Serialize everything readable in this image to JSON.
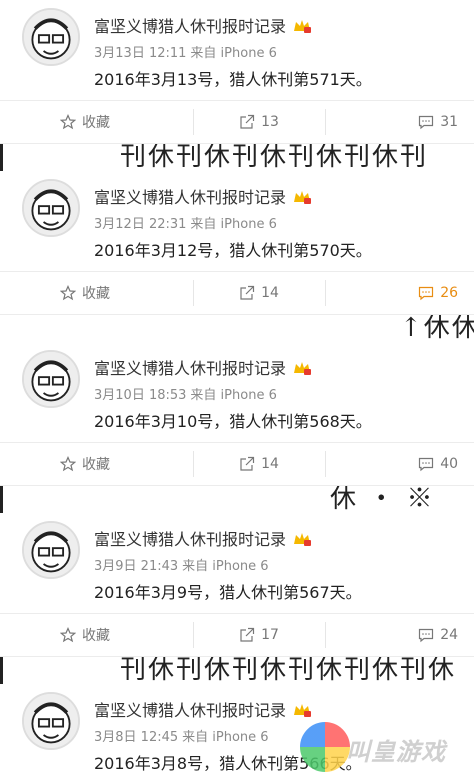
{
  "posts": [
    {
      "name": "富坚义博猎人休刊报时记录",
      "date": "3月13日 12:11",
      "source": "来自 iPhone 6",
      "text": "2016年3月13号，猎人休刊第571天。",
      "fav": "收藏",
      "repost": "13",
      "comment": "31",
      "comment_hot": false
    },
    {
      "name": "富坚义博猎人休刊报时记录",
      "date": "3月12日 22:31",
      "source": "来自 iPhone 6",
      "text": "2016年3月12号，猎人休刊第570天。",
      "fav": "收藏",
      "repost": "14",
      "comment": "26",
      "comment_hot": true
    },
    {
      "name": "富坚义博猎人休刊报时记录",
      "date": "3月10日 18:53",
      "source": "来自 iPhone 6",
      "text": "2016年3月10号，猎人休刊第568天。",
      "fav": "收藏",
      "repost": "14",
      "comment": "40",
      "comment_hot": false
    },
    {
      "name": "富坚义博猎人休刊报时记录",
      "date": "3月9日 21:43",
      "source": "来自 iPhone 6",
      "text": "2016年3月9号，猎人休刊第567天。",
      "fav": "收藏",
      "repost": "17",
      "comment": "24",
      "comment_hot": false
    },
    {
      "name": "富坚义博猎人休刊报时记录",
      "date": "3月8日 12:45",
      "source": "来自 iPhone 6",
      "text": "2016年3月8号，猎人休刊第566天。",
      "fav": "",
      "repost": "",
      "comment": "",
      "comment_hot": false
    }
  ],
  "strips": [
    "刊休刊休刊休刊休刊休刊",
    "↑休休",
    "休 ・ ※",
    "刊休刊休刊休刊休刊休刊休"
  ],
  "watermark": "叫皇游戏",
  "colors": {
    "hot_comment": "#e88d13",
    "meta": "#8a8a8a"
  }
}
